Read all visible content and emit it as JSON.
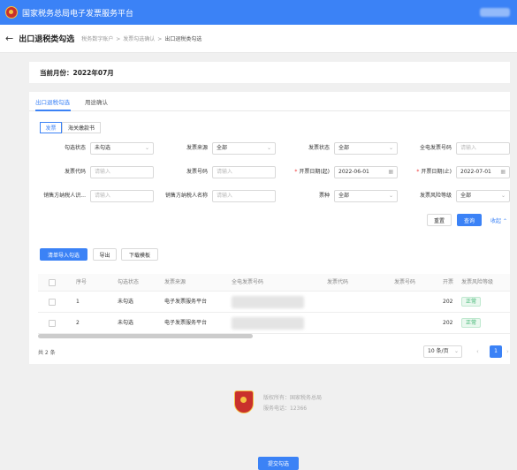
{
  "app": {
    "title": "国家税务总局电子发票服务平台"
  },
  "header": {
    "title": "出口退税类勾选",
    "breadcrumb": [
      "税务数字账户",
      "发票勾选确认",
      "出口退税类勾选"
    ]
  },
  "month": {
    "label": "当前月份：2022年07月"
  },
  "tabs": [
    "出口退税勾选",
    "用途确认"
  ],
  "subtabs": [
    "发票",
    "海关缴款书"
  ],
  "filters": {
    "status_label": "勾选状态",
    "status_value": "未勾选",
    "source_label": "发票来源",
    "source_value": "全部",
    "invstatus_label": "发票状态",
    "invstatus_value": "全部",
    "fullnum_label": "全电发票号码",
    "fullnum_placeholder": "请输入",
    "code_label": "发票代码",
    "code_placeholder": "请输入",
    "number_label": "发票号码",
    "number_placeholder": "请输入",
    "date_start_label": "开票日期(起)",
    "date_start_value": "2022-06-01",
    "date_end_label": "开票日期(止)",
    "date_end_value": "2022-07-01",
    "seller_id_label": "销售方纳税人识...",
    "seller_id_placeholder": "请输入",
    "seller_name_label": "销售方纳税人名称",
    "seller_name_placeholder": "请输入",
    "type_label": "票种",
    "type_value": "全部",
    "risk_label": "发票风险等级",
    "risk_value": "全部",
    "required_mark": "*"
  },
  "actions": {
    "reset": "重置",
    "query": "查询",
    "collapse": "收起"
  },
  "toolbar": {
    "import": "清单导入勾选",
    "export": "导出",
    "template": "下载模板"
  },
  "table": {
    "headers": [
      "序号",
      "勾选状态",
      "发票来源",
      "全电发票号码",
      "发票代码",
      "发票号码",
      "开票",
      "发票风险等级"
    ],
    "rows": [
      {
        "index": "1",
        "status": "未勾选",
        "source": "电子发票服务平台",
        "date": "202",
        "risk": "正常"
      },
      {
        "index": "2",
        "status": "未勾选",
        "source": "电子发票服务平台",
        "date": "202",
        "risk": "正常"
      }
    ]
  },
  "pagination": {
    "total": "共 2 条",
    "page_size": "10 条/页",
    "current": "1",
    "prev": "‹",
    "next": "›"
  },
  "footer": {
    "owner": "版权所有：国家税务总局",
    "phone": "服务电话：12366"
  },
  "submit": "提交勾选",
  "colors": {
    "primary": "#3b82f6",
    "success": "#3bb36f"
  },
  "icons": {
    "back": "arrow-left-icon",
    "calendar": "calendar-icon",
    "chevron": "chevron-down-icon"
  }
}
